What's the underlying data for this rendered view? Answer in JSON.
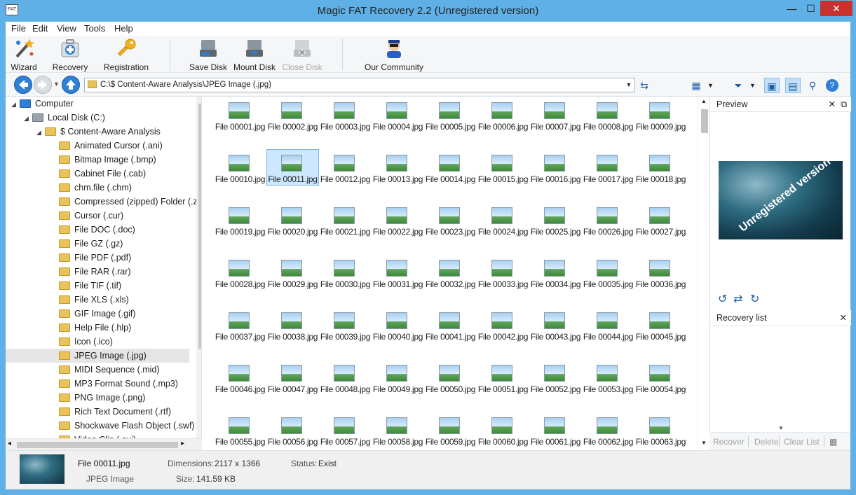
{
  "window": {
    "title": "Magic FAT Recovery 2.2 (Unregistered version)",
    "icon_text": "FAT",
    "min": "—",
    "max": "☐",
    "close": "✕"
  },
  "menu": [
    "File",
    "Edit",
    "View",
    "Tools",
    "Help"
  ],
  "toolbar": {
    "wizard": "Wizard",
    "recovery": "Recovery",
    "registration": "Registration",
    "save_disk": "Save Disk",
    "mount_disk": "Mount Disk",
    "close_disk": "Close Disk",
    "community": "Our Community"
  },
  "address": {
    "path": "C:\\$ Content-Aware Analysis\\JPEG Image (.jpg)"
  },
  "tree": {
    "computer": "Computer",
    "disk": "Local Disk (C:)",
    "analysis": "$ Content-Aware Analysis",
    "folders": [
      "Animated Cursor (.ani)",
      "Bitmap Image (.bmp)",
      "Cabinet File (.cab)",
      "chm.file (.chm)",
      "Compressed (zipped) Folder (.zip)",
      "Cursor (.cur)",
      "File DOC (.doc)",
      "File GZ (.gz)",
      "File PDF (.pdf)",
      "File RAR (.rar)",
      "File TIF (.tif)",
      "File XLS (.xls)",
      "GIF Image (.gif)",
      "Help File (.hlp)",
      "Icon (.ico)",
      "JPEG Image (.jpg)",
      "MIDI Sequence (.mid)",
      "MP3 Format Sound (.mp3)",
      "PNG Image (.png)",
      "Rich Text Document (.rtf)",
      "Shockwave Flash Object (.swf)",
      "Video Clip (.avi)"
    ],
    "selected": "JPEG Image (.jpg)"
  },
  "files": [
    "File 00001.jpg",
    "File 00002.jpg",
    "File 00003.jpg",
    "File 00004.jpg",
    "File 00005.jpg",
    "File 00006.jpg",
    "File 00007.jpg",
    "File 00008.jpg",
    "File 00009.jpg",
    "File 00010.jpg",
    "File 00011.jpg",
    "File 00012.jpg",
    "File 00013.jpg",
    "File 00014.jpg",
    "File 00015.jpg",
    "File 00016.jpg",
    "File 00017.jpg",
    "File 00018.jpg",
    "File 00019.jpg",
    "File 00020.jpg",
    "File 00021.jpg",
    "File 00022.jpg",
    "File 00023.jpg",
    "File 00024.jpg",
    "File 00025.jpg",
    "File 00026.jpg",
    "File 00027.jpg",
    "File 00028.jpg",
    "File 00029.jpg",
    "File 00030.jpg",
    "File 00031.jpg",
    "File 00032.jpg",
    "File 00033.jpg",
    "File 00034.jpg",
    "File 00035.jpg",
    "File 00036.jpg",
    "File 00037.jpg",
    "File 00038.jpg",
    "File 00039.jpg",
    "File 00040.jpg",
    "File 00041.jpg",
    "File 00042.jpg",
    "File 00043.jpg",
    "File 00044.jpg",
    "File 00045.jpg",
    "File 00046.jpg",
    "File 00047.jpg",
    "File 00048.jpg",
    "File 00049.jpg",
    "File 00050.jpg",
    "File 00051.jpg",
    "File 00052.jpg",
    "File 00053.jpg",
    "File 00054.jpg",
    "File 00055.jpg",
    "File 00056.jpg",
    "File 00057.jpg",
    "File 00058.jpg",
    "File 00059.jpg",
    "File 00060.jpg",
    "File 00061.jpg",
    "File 00062.jpg",
    "File 00063.jpg"
  ],
  "selected_file": "File 00011.jpg",
  "preview": {
    "title": "Preview",
    "watermark": "Unregistered version"
  },
  "recovery_list": {
    "title": "Recovery list",
    "recover": "Recover",
    "delete": "Delete",
    "clear": "Clear List"
  },
  "status": {
    "name": "File 00011.jpg",
    "type": "JPEG Image",
    "dimensions_label": "Dimensions:",
    "dimensions": "2117 x 1366",
    "size_label": "Size:",
    "size": "141.59 KB",
    "status_label": "Status:",
    "status": "Exist"
  }
}
